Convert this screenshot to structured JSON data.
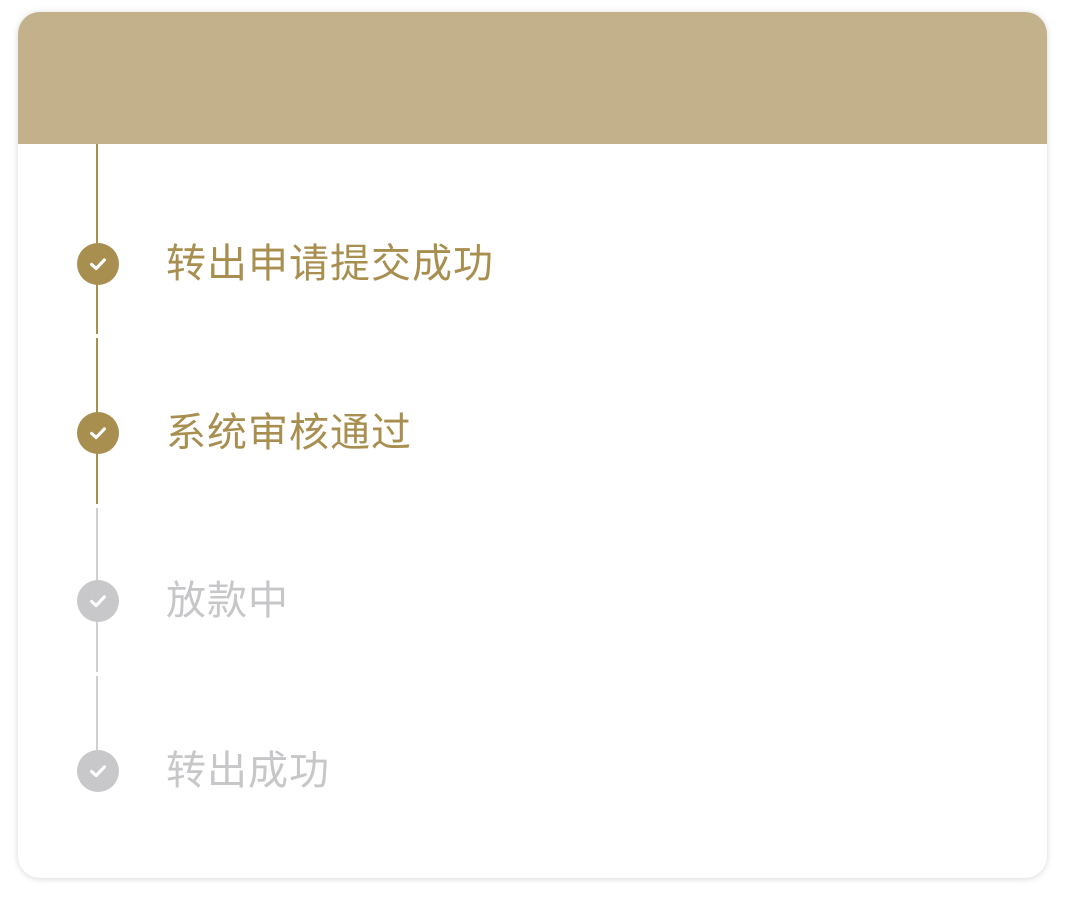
{
  "colors": {
    "header": "#c2b18a",
    "active": "#a88f4f",
    "pending": "#c8c8cb",
    "pending_text": "#c7c7ca",
    "card_background": "#ffffff"
  },
  "steps": [
    {
      "label": "转出申请提交成功",
      "status": "completed",
      "icon": "check-circle-icon"
    },
    {
      "label": "系统审核通过",
      "status": "completed",
      "icon": "check-circle-icon"
    },
    {
      "label": "放款中",
      "status": "pending",
      "icon": "check-circle-icon"
    },
    {
      "label": "转出成功",
      "status": "pending",
      "icon": "check-circle-icon"
    }
  ]
}
